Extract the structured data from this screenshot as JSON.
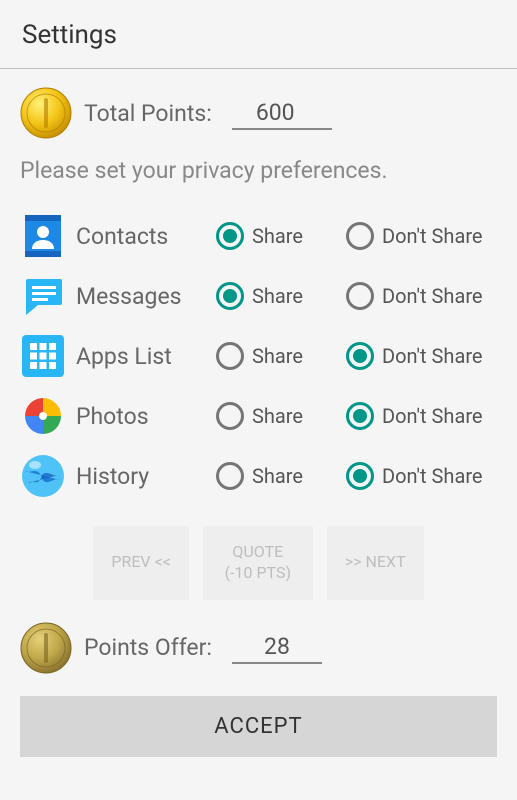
{
  "header": {
    "title": "Settings"
  },
  "points": {
    "label": "Total Points:",
    "value": "600"
  },
  "instruction": "Please set your privacy preferences.",
  "shareLabel": "Share",
  "dontShareLabel": "Don't Share",
  "prefs": {
    "contacts": {
      "label": "Contacts",
      "selected": "share"
    },
    "messages": {
      "label": "Messages",
      "selected": "share"
    },
    "apps": {
      "label": "Apps List",
      "selected": "dont"
    },
    "photos": {
      "label": "Photos",
      "selected": "dont"
    },
    "history": {
      "label": "History",
      "selected": "dont"
    }
  },
  "buttons": {
    "prev": "PREV <<",
    "quote_line1": "QUOTE",
    "quote_line2": "(-10 PTS)",
    "next": ">> NEXT",
    "accept": "ACCEPT"
  },
  "offer": {
    "label": "Points Offer:",
    "value": "28"
  }
}
